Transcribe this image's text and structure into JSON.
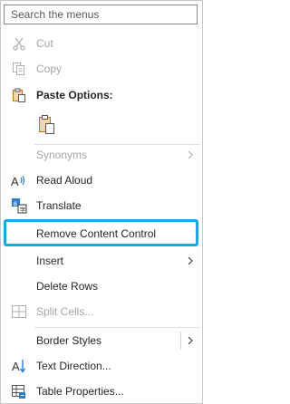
{
  "search": {
    "placeholder": "Search the menus"
  },
  "items": {
    "cut": {
      "label": "Cut",
      "icon": "scissors-icon"
    },
    "copy": {
      "label": "Copy",
      "icon": "copy-icon"
    },
    "paste_options": {
      "label": "Paste Options:",
      "icon": "clipboard-icon"
    },
    "synonyms": {
      "label": "Synonyms"
    },
    "read_aloud": {
      "label": "Read Aloud",
      "icon": "read-aloud-icon"
    },
    "translate": {
      "label": "Translate",
      "icon": "translate-icon"
    },
    "remove_content_control": {
      "label": "Remove Content Control"
    },
    "insert": {
      "label": "Insert"
    },
    "delete_rows": {
      "label": "Delete Rows"
    },
    "split_cells": {
      "label": "Split Cells..."
    },
    "border_styles": {
      "label": "Border Styles"
    },
    "text_direction": {
      "label": "Text Direction...",
      "icon": "text-direction-icon"
    },
    "table_properties": {
      "label": "Table Properties...",
      "icon": "table-properties-icon"
    }
  },
  "colors": {
    "highlight_border": "#19a9e0",
    "disabled_text": "#a6a6a6",
    "accent_icon": "#2b7cd3",
    "clipboard_orange": "#c7711e"
  }
}
